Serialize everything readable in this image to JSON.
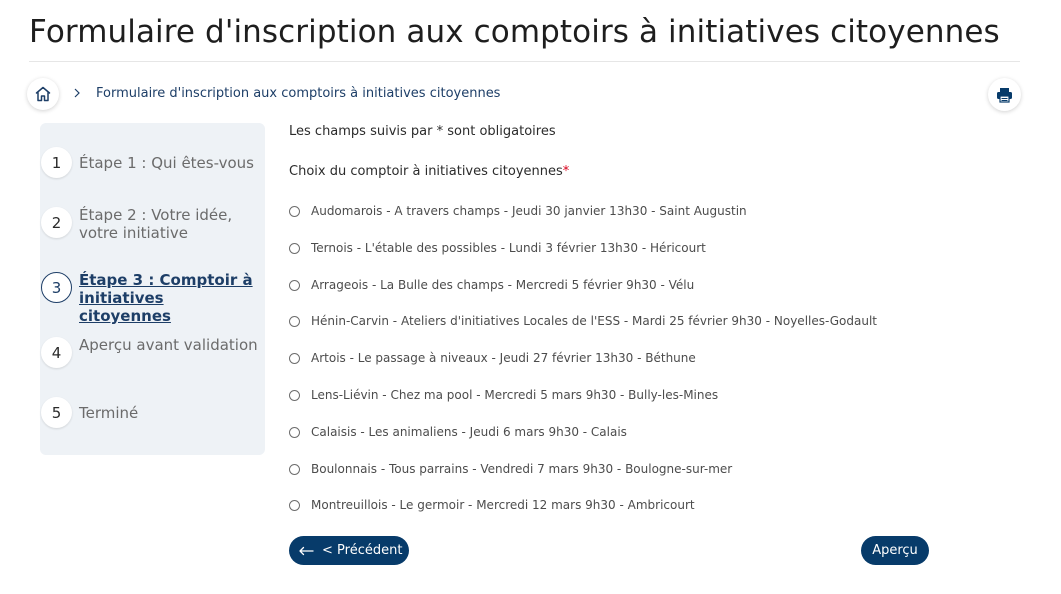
{
  "page": {
    "title": "Formulaire d'inscription aux comptoirs à initiatives citoyennes"
  },
  "breadcrumb": {
    "home_icon": "home-icon",
    "separator_icon": "chevron-right-icon",
    "current": "Formulaire d'inscription aux comptoirs à initiatives citoyennes"
  },
  "toolbar": {
    "print_icon": "printer-icon"
  },
  "steps": [
    {
      "number": "1",
      "label": "Étape 1 : Qui êtes-vous",
      "active": false
    },
    {
      "number": "2",
      "label": "Étape 2 : Votre idée, votre initiative",
      "active": false
    },
    {
      "number": "3",
      "label": "Étape 3 : Comptoir à initiatives citoyennes",
      "active": true
    },
    {
      "number": "4",
      "label": "Aperçu avant validation",
      "active": false
    },
    {
      "number": "5",
      "label": "Terminé",
      "active": false
    }
  ],
  "form": {
    "required_note": "Les champs suivis par * sont obligatoires",
    "field_label": "Choix du comptoir à initiatives citoyennes",
    "required_marker": "*",
    "options": [
      "Audomarois - A travers champs - Jeudi 30 janvier 13h30 - Saint Augustin",
      "Ternois - L'étable des possibles - Lundi 3 février 13h30 - Héricourt",
      "Arrageois - La Bulle des champs - Mercredi 5 février 9h30 - Vélu",
      "Hénin-Carvin - Ateliers d'initiatives Locales de l'ESS - Mardi 25 février 9h30 - Noyelles-Godault",
      "Artois - Le passage à niveaux - Jeudi 27 février 13h30 - Béthune",
      "Lens-Liévin - Chez ma pool - Mercredi 5 mars 9h30 - Bully-les-Mines",
      "Calaisis - Les animaliens - Jeudi 6 mars 9h30 - Calais",
      "Boulonnais - Tous parrains - Vendredi 7 mars 9h30 - Boulogne-sur-mer",
      "Montreuillois - Le germoir - Mercredi 12 mars 9h30 - Ambricourt"
    ],
    "selected_index": null
  },
  "buttons": {
    "previous_label": "< Précédent",
    "previous_icon": "arrow-left-icon",
    "next_label": "Aperçu"
  },
  "colors": {
    "primary": "#073b6a",
    "link": "#1d3e67",
    "required": "#d8001b",
    "sidebar_bg": "#eef2f6"
  }
}
